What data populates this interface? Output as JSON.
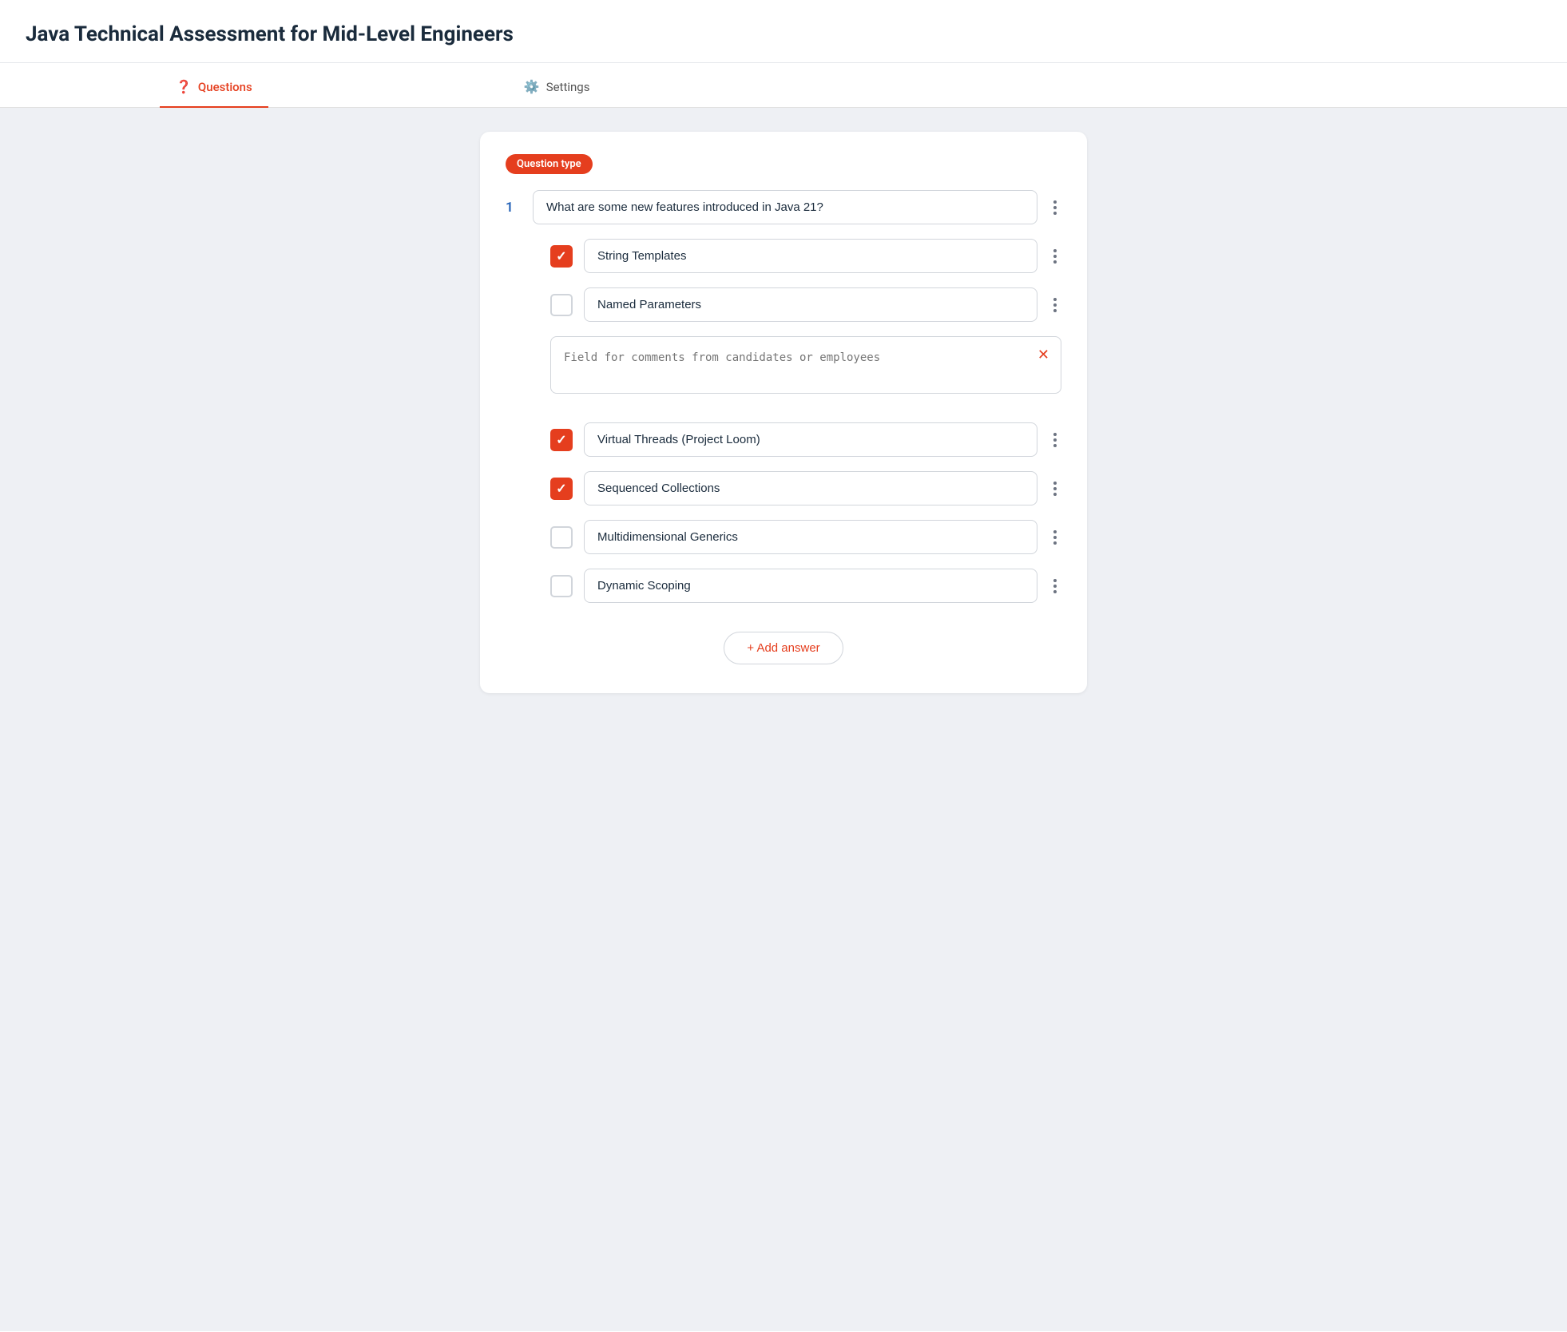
{
  "header": {
    "title": "Java Technical Assessment for Mid-Level Engineers"
  },
  "tabs": [
    {
      "id": "questions",
      "label": "Questions",
      "icon": "❓",
      "active": true
    },
    {
      "id": "settings",
      "label": "Settings",
      "icon": "⚙️",
      "active": false
    }
  ],
  "form": {
    "question_type_badge": "Question type",
    "question": {
      "number": "1",
      "text": "What are some new features introduced in Java 21?"
    },
    "answers": [
      {
        "id": "a1",
        "text": "String Templates",
        "checked": true
      },
      {
        "id": "a2",
        "text": "Named Parameters",
        "checked": false
      },
      {
        "id": "comment",
        "type": "comment",
        "placeholder": "Field for comments from candidates or employees"
      },
      {
        "id": "a3",
        "text": "Virtual Threads (Project Loom)",
        "checked": true
      },
      {
        "id": "a4",
        "text": "Sequenced Collections",
        "checked": true
      },
      {
        "id": "a5",
        "text": "Multidimensional Generics",
        "checked": false
      },
      {
        "id": "a6",
        "text": "Dynamic Scoping",
        "checked": false
      }
    ],
    "add_answer_label": "+ Add answer"
  },
  "colors": {
    "accent": "#e53e1e",
    "active_tab_underline": "#e53e1e",
    "checkbox_checked": "#e53e1e",
    "question_number": "#2563b8"
  }
}
